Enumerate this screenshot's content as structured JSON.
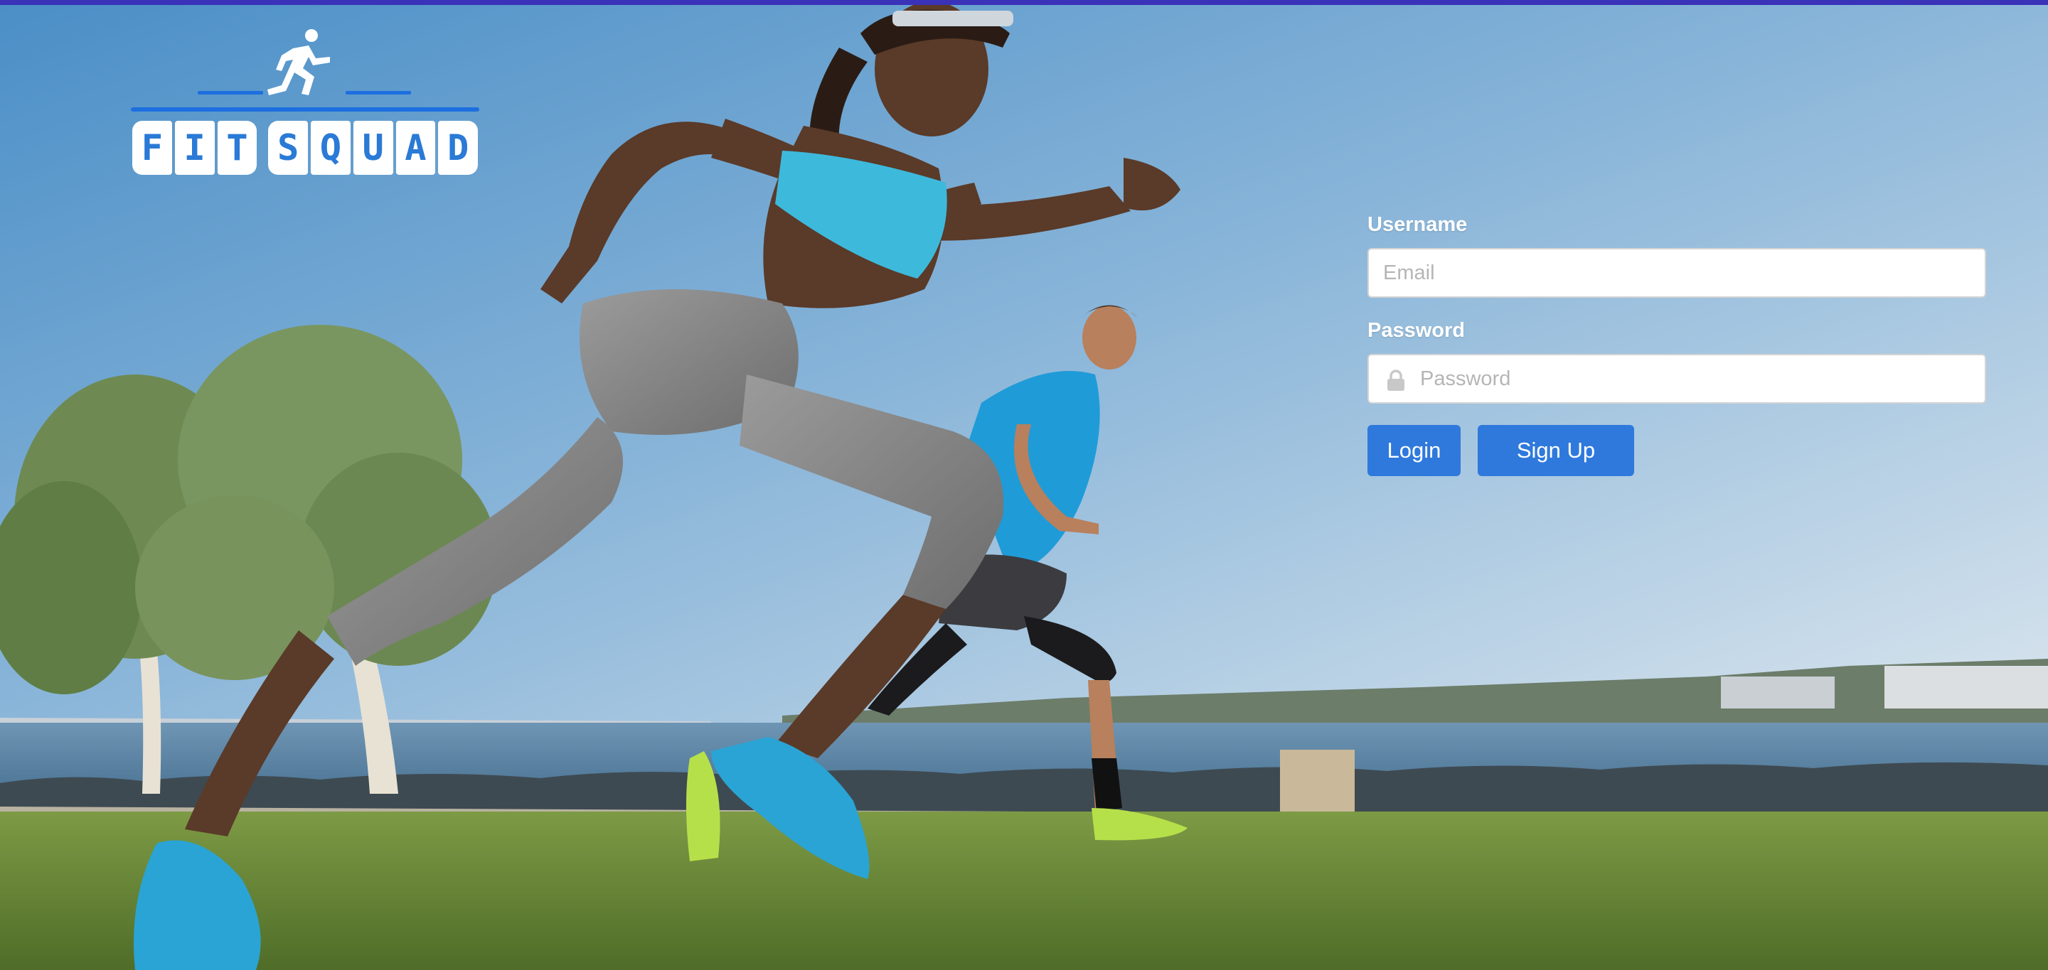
{
  "brand": {
    "logo_letters": [
      "F",
      "I",
      "T",
      "S",
      "Q",
      "U",
      "A",
      "D"
    ],
    "accent": "#1d6fe0",
    "logo_icon": "running-man-icon"
  },
  "login_form": {
    "username_label": "Username",
    "username_placeholder": "Email",
    "username_value": "",
    "password_label": "Password",
    "password_placeholder": "Password",
    "password_value": "",
    "password_icon": "lock-icon",
    "login_label": "Login",
    "signup_label": "Sign Up",
    "button_color": "#2f79dc"
  },
  "background": {
    "image": "hero-photo",
    "sky_color": "#8fb9dc",
    "grass_color": "#6a8a3a",
    "water_color": "#5f86a6"
  }
}
